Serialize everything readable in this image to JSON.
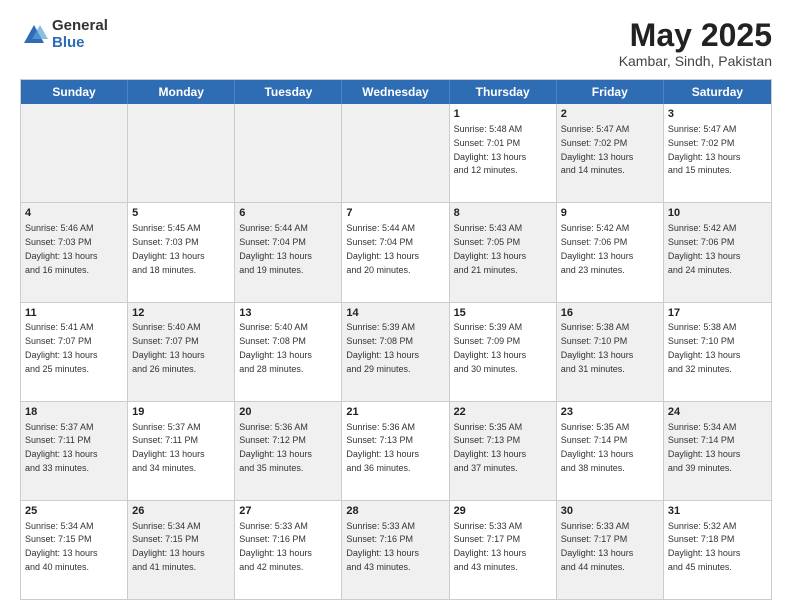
{
  "logo": {
    "general": "General",
    "blue": "Blue"
  },
  "title": {
    "month_year": "May 2025",
    "location": "Kambar, Sindh, Pakistan"
  },
  "weekdays": [
    "Sunday",
    "Monday",
    "Tuesday",
    "Wednesday",
    "Thursday",
    "Friday",
    "Saturday"
  ],
  "rows": [
    [
      {
        "day": "",
        "info": "",
        "shaded": true
      },
      {
        "day": "",
        "info": "",
        "shaded": true
      },
      {
        "day": "",
        "info": "",
        "shaded": true
      },
      {
        "day": "",
        "info": "",
        "shaded": true
      },
      {
        "day": "1",
        "info": "Sunrise: 5:48 AM\nSunset: 7:01 PM\nDaylight: 13 hours\nand 12 minutes."
      },
      {
        "day": "2",
        "info": "Sunrise: 5:47 AM\nSunset: 7:02 PM\nDaylight: 13 hours\nand 14 minutes.",
        "shaded": true
      },
      {
        "day": "3",
        "info": "Sunrise: 5:47 AM\nSunset: 7:02 PM\nDaylight: 13 hours\nand 15 minutes."
      }
    ],
    [
      {
        "day": "4",
        "info": "Sunrise: 5:46 AM\nSunset: 7:03 PM\nDaylight: 13 hours\nand 16 minutes.",
        "shaded": true
      },
      {
        "day": "5",
        "info": "Sunrise: 5:45 AM\nSunset: 7:03 PM\nDaylight: 13 hours\nand 18 minutes."
      },
      {
        "day": "6",
        "info": "Sunrise: 5:44 AM\nSunset: 7:04 PM\nDaylight: 13 hours\nand 19 minutes.",
        "shaded": true
      },
      {
        "day": "7",
        "info": "Sunrise: 5:44 AM\nSunset: 7:04 PM\nDaylight: 13 hours\nand 20 minutes."
      },
      {
        "day": "8",
        "info": "Sunrise: 5:43 AM\nSunset: 7:05 PM\nDaylight: 13 hours\nand 21 minutes.",
        "shaded": true
      },
      {
        "day": "9",
        "info": "Sunrise: 5:42 AM\nSunset: 7:06 PM\nDaylight: 13 hours\nand 23 minutes."
      },
      {
        "day": "10",
        "info": "Sunrise: 5:42 AM\nSunset: 7:06 PM\nDaylight: 13 hours\nand 24 minutes.",
        "shaded": true
      }
    ],
    [
      {
        "day": "11",
        "info": "Sunrise: 5:41 AM\nSunset: 7:07 PM\nDaylight: 13 hours\nand 25 minutes."
      },
      {
        "day": "12",
        "info": "Sunrise: 5:40 AM\nSunset: 7:07 PM\nDaylight: 13 hours\nand 26 minutes.",
        "shaded": true
      },
      {
        "day": "13",
        "info": "Sunrise: 5:40 AM\nSunset: 7:08 PM\nDaylight: 13 hours\nand 28 minutes."
      },
      {
        "day": "14",
        "info": "Sunrise: 5:39 AM\nSunset: 7:08 PM\nDaylight: 13 hours\nand 29 minutes.",
        "shaded": true
      },
      {
        "day": "15",
        "info": "Sunrise: 5:39 AM\nSunset: 7:09 PM\nDaylight: 13 hours\nand 30 minutes."
      },
      {
        "day": "16",
        "info": "Sunrise: 5:38 AM\nSunset: 7:10 PM\nDaylight: 13 hours\nand 31 minutes.",
        "shaded": true
      },
      {
        "day": "17",
        "info": "Sunrise: 5:38 AM\nSunset: 7:10 PM\nDaylight: 13 hours\nand 32 minutes."
      }
    ],
    [
      {
        "day": "18",
        "info": "Sunrise: 5:37 AM\nSunset: 7:11 PM\nDaylight: 13 hours\nand 33 minutes.",
        "shaded": true
      },
      {
        "day": "19",
        "info": "Sunrise: 5:37 AM\nSunset: 7:11 PM\nDaylight: 13 hours\nand 34 minutes."
      },
      {
        "day": "20",
        "info": "Sunrise: 5:36 AM\nSunset: 7:12 PM\nDaylight: 13 hours\nand 35 minutes.",
        "shaded": true
      },
      {
        "day": "21",
        "info": "Sunrise: 5:36 AM\nSunset: 7:13 PM\nDaylight: 13 hours\nand 36 minutes."
      },
      {
        "day": "22",
        "info": "Sunrise: 5:35 AM\nSunset: 7:13 PM\nDaylight: 13 hours\nand 37 minutes.",
        "shaded": true
      },
      {
        "day": "23",
        "info": "Sunrise: 5:35 AM\nSunset: 7:14 PM\nDaylight: 13 hours\nand 38 minutes."
      },
      {
        "day": "24",
        "info": "Sunrise: 5:34 AM\nSunset: 7:14 PM\nDaylight: 13 hours\nand 39 minutes.",
        "shaded": true
      }
    ],
    [
      {
        "day": "25",
        "info": "Sunrise: 5:34 AM\nSunset: 7:15 PM\nDaylight: 13 hours\nand 40 minutes."
      },
      {
        "day": "26",
        "info": "Sunrise: 5:34 AM\nSunset: 7:15 PM\nDaylight: 13 hours\nand 41 minutes.",
        "shaded": true
      },
      {
        "day": "27",
        "info": "Sunrise: 5:33 AM\nSunset: 7:16 PM\nDaylight: 13 hours\nand 42 minutes."
      },
      {
        "day": "28",
        "info": "Sunrise: 5:33 AM\nSunset: 7:16 PM\nDaylight: 13 hours\nand 43 minutes.",
        "shaded": true
      },
      {
        "day": "29",
        "info": "Sunrise: 5:33 AM\nSunset: 7:17 PM\nDaylight: 13 hours\nand 43 minutes."
      },
      {
        "day": "30",
        "info": "Sunrise: 5:33 AM\nSunset: 7:17 PM\nDaylight: 13 hours\nand 44 minutes.",
        "shaded": true
      },
      {
        "day": "31",
        "info": "Sunrise: 5:32 AM\nSunset: 7:18 PM\nDaylight: 13 hours\nand 45 minutes."
      }
    ]
  ]
}
